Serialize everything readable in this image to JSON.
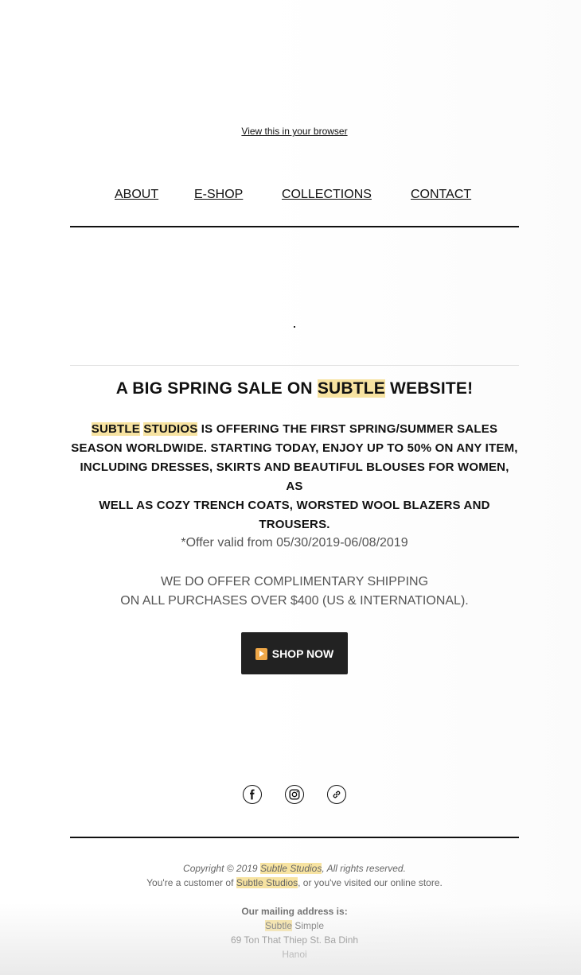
{
  "header": {
    "view_in_browser": "View this in your browser"
  },
  "nav": {
    "about": "ABOUT",
    "eshop": "E-SHOP",
    "collections": "COLLECTIONS",
    "contact": "CONTACT"
  },
  "headline": {
    "pre": "A BIG SPRING SALE ON ",
    "brand": "SUBTLE",
    "post": " WEBSITE!"
  },
  "body": {
    "brand_1": "SUBTLE",
    "brand_2": "STUDIOS",
    "line_1_rest": " IS OFFERING THE FIRST SPRING/SUMMER SALES",
    "line_2": "SEASON WORLDWIDE. STARTING TODAY, ENJOY UP TO 50% ON ANY ITEM,",
    "line_3": "INCLUDING DRESSES, SKIRTS AND BEAUTIFUL BLOUSES FOR WOMEN, AS",
    "line_4": "WELL AS COZY TRENCH COATS, WORSTED WOOL BLAZERS AND",
    "line_5": "TROUSERS."
  },
  "offer": {
    "validity": "*Offer valid from 05/30/2019-06/08/2019"
  },
  "shipping": {
    "line_1": "WE DO OFFER COMPLIMENTARY SHIPPING",
    "line_2": "ON ALL PURCHASES OVER $400 (US & INTERNATIONAL)."
  },
  "cta": {
    "label": "SHOP NOW",
    "icon": "play-icon",
    "icon_color": "#f0a848"
  },
  "social": {
    "icons": [
      "facebook-icon",
      "instagram-icon",
      "link-icon"
    ]
  },
  "footer": {
    "copyright_pre": "Copyright © 2019 ",
    "copyright_brand": "Subtle Studios",
    "copyright_post": ", All rights reserved.",
    "customer_pre": "You're a customer of ",
    "customer_brand": "Subtle Studios",
    "customer_post": ", or you've visited our online store.",
    "mailing_title": "Our mailing address is:",
    "addr_brand": "Subtle",
    "addr_name_rest": " Simple",
    "addr_street": "69 Ton That Thiep St. Ba Dinh",
    "addr_city": "Hanoi"
  },
  "colors": {
    "highlight": "#f7e3a1",
    "button_bg": "#222222",
    "text": "#111111",
    "muted": "#555555"
  }
}
